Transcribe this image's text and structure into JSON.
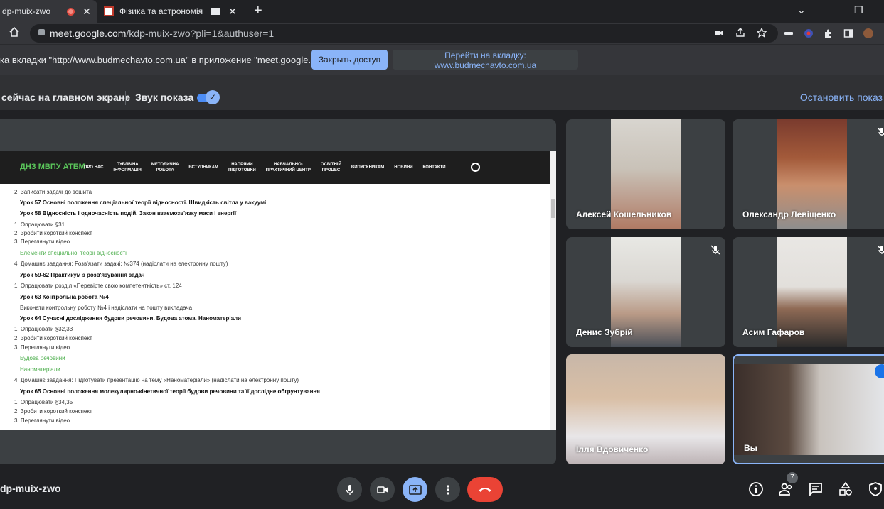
{
  "browser": {
    "tabs": [
      {
        "title": "dp-muix-zwo",
        "active": true
      },
      {
        "title": "Фізика та астрономія",
        "active": false
      }
    ],
    "url_host": "meet.google.com",
    "url_path": "/kdp-muix-zwo?pli=1&authuser=1"
  },
  "share_bar": {
    "message": "ка вкладки \"http://www.budmechavto.com.ua\" в приложение \"meet.google.com\"...",
    "stop_button": "Закрыть доступ",
    "go_tab_button": "Перейти на вкладку: www.budmechavto.com.ua"
  },
  "meet_bar": {
    "presenting_text": "сейчас на главном экране",
    "sound_label": "Звук показа",
    "sound_enabled": true,
    "stop_label": "Остановить показ"
  },
  "shared_site": {
    "logo": "ДНЗ МВПУ АТБМ",
    "nav": [
      "ПРО НАС",
      "ПУБЛІЧНА\nІНФОРМАЦІЯ",
      "МЕТОДИЧНА\nРОБОТА",
      "ВСТУПНИКАМ",
      "НАПРЯМИ\nПІДГОТОВКИ",
      "НАВЧАЛЬНО-\nПРАКТИЧНИЙ ЦЕНТР",
      "ОСВІТНІЙ\nПРОЦЕС",
      "ВИПУСКНИКАМ",
      "НОВИНИ",
      "КОНТАКТИ"
    ],
    "lines": [
      "2. Записати задачі до зошита",
      "Урок 57 Основні положення спеціальної теорії відносності. Швидкість світла у вакуумі",
      "Урок 58 Відносність і одночасність подій. Закон взаємозв'язку маси і енергії",
      "1. Опрацювати §31",
      "2. Зробити короткий конспект",
      "3. Переглянути відео",
      "Елементи спеціальної теорії відносності",
      "4. Домашнє завдання: Розв'язати задачі: №374 (надіслати на електронну пошту)",
      "Урок 59-62 Практикум з розв'язування задач",
      "1. Опрацювати розділ «Перевірте свою компетентність» ст. 124",
      "Урок 63 Контрольна робота №4",
      "Виконати контрольну роботу №4 і надіслати на пошту викладача",
      "Урок 64 Сучасні дослідження будови речовини. Будова атома. Наноматеріали",
      "1. Опрацювати §32,33",
      "2. Зробити короткий конспект",
      "3. Переглянути відео",
      "Будова речовини",
      "Наноматеріали",
      "4. Домашнє завдання: Підготувати презентацію на тему «Наноматеріали» (надіслати на електронну пошту)",
      "Урок 65 Основні положення молекулярно-кінетичної теорії будови речовини та її дослідне обгрунтування",
      "1. Опрацювати §34,35",
      "2. Зробити короткий конспект",
      "3. Переглянути відео"
    ]
  },
  "participants": [
    {
      "name": "Алексей Кошельников",
      "muted": false
    },
    {
      "name": "Олександр Левіщенко",
      "muted": true
    },
    {
      "name": "Денис Зубрій",
      "muted": true
    },
    {
      "name": "Асим Гафаров",
      "muted": true
    },
    {
      "name": "Ілля Вдовиченко",
      "muted": false
    },
    {
      "name": "Вы",
      "muted": false
    }
  ],
  "bottom_bar": {
    "meeting_code": "dp-muix-zwo",
    "participants_count": "7"
  },
  "colors": {
    "accent": "#8ab4f8",
    "hangup": "#ea4335",
    "site_green": "#4cae4c"
  }
}
